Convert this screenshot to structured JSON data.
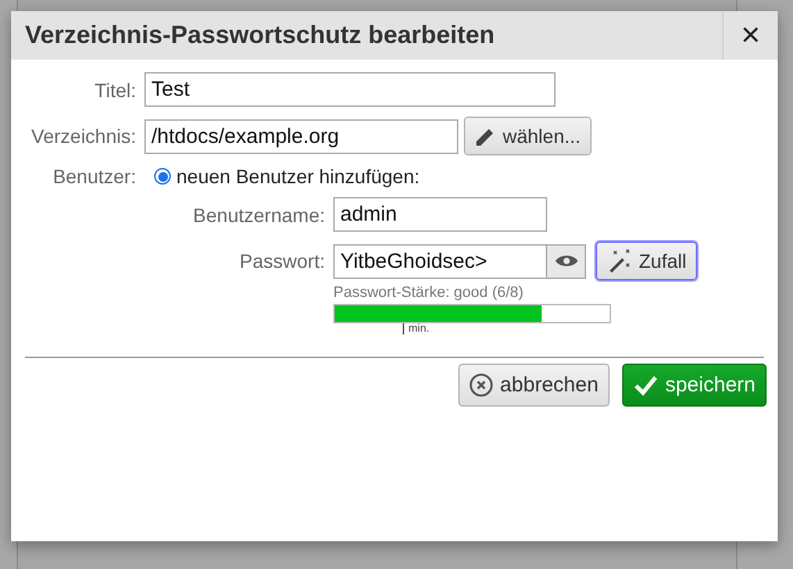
{
  "dialog": {
    "title": "Verzeichnis-Passwortschutz bearbeiten",
    "close": "×"
  },
  "fields": {
    "title": {
      "label": "Titel:",
      "value": "Test"
    },
    "directory": {
      "label": "Verzeichnis:",
      "value": "/htdocs/example.org",
      "button": "wählen..."
    },
    "user": {
      "label": "Benutzer:",
      "option": "neuen Benutzer hinzufügen:",
      "selected": true
    },
    "username": {
      "label": "Benutzername:",
      "value": "admin"
    },
    "password": {
      "label": "Passwort:",
      "value": "YitbeGhoidsec>",
      "button": "Zufall",
      "button_focused": true
    }
  },
  "strength": {
    "text": "Passwort-Stärke: good (6/8)",
    "level": 0.75,
    "min_label": "min."
  },
  "buttons": [
    {
      "kind": "cancel",
      "label": "abbrechen"
    },
    {
      "kind": "save",
      "label": "speichern"
    }
  ]
}
